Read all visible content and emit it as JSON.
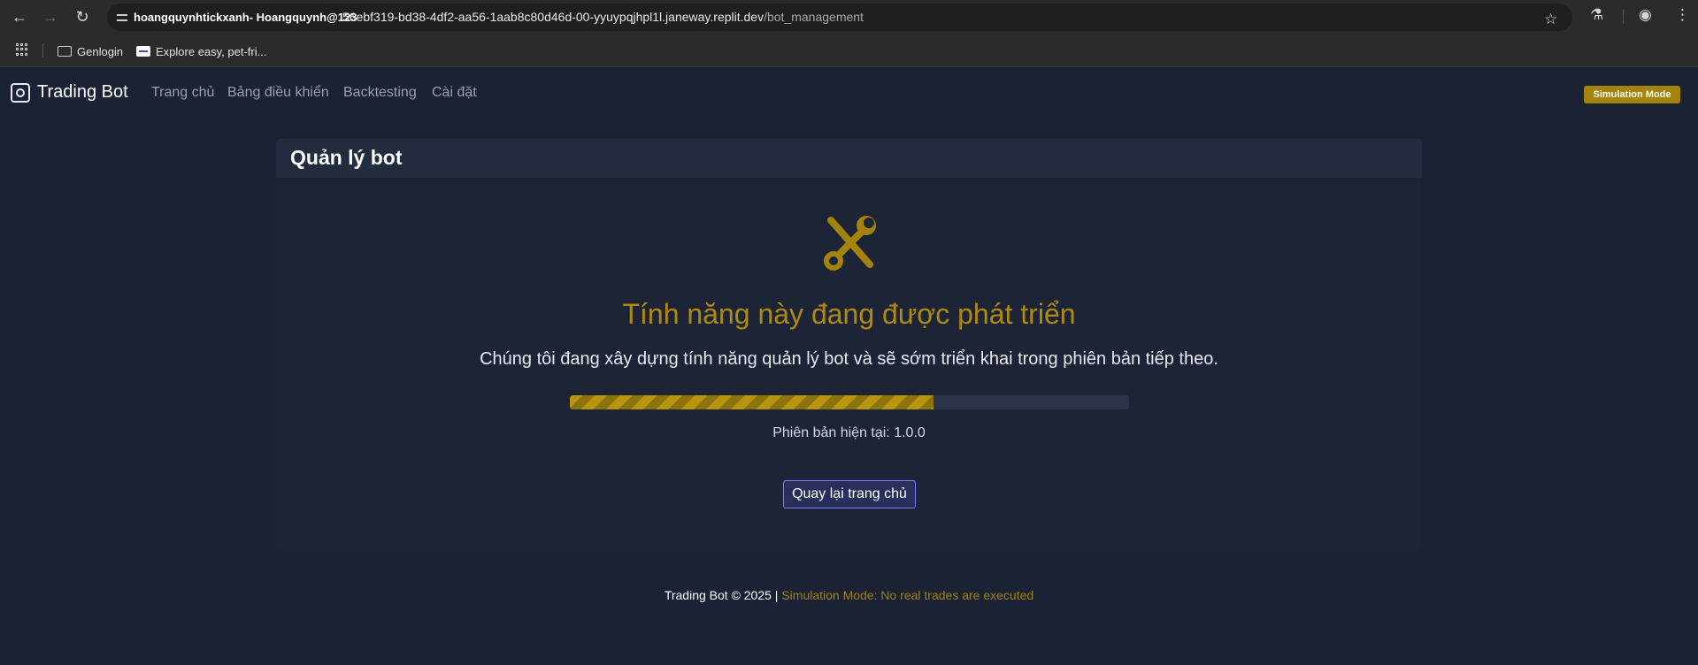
{
  "browser": {
    "site_chip": "hoangquynhtickxanh- Hoangquynh@123",
    "url_host": "56ebf319-bd38-4df2-aa56-1aab8c80d46d-00-yyuypqjhpl1l.janeway.replit.dev",
    "url_path": "/bot_management",
    "bookmarks": [
      {
        "label": "Genlogin",
        "icon": "folder-icon"
      },
      {
        "label": "Explore easy, pet-fri...",
        "icon": "site-favicon"
      }
    ]
  },
  "navbar": {
    "brand": "Trading Bot",
    "links": [
      "Trang chủ",
      "Bảng điều khiển",
      "Backtesting",
      "Cài đặt"
    ],
    "badge": "Simulation Mode"
  },
  "card": {
    "title": "Quản lý bot",
    "icon": "tools-icon",
    "heading": "Tính năng này đang được phát triển",
    "description": "Chúng tôi đang xây dựng tính năng quản lý bot và sẽ sớm triển khai trong phiên bản tiếp theo.",
    "progress_percent": 65,
    "version_text": "Phiên bản hiện tại: 1.0.0",
    "button_label": "Quay lại trang chủ"
  },
  "footer": {
    "text": "Trading Bot © 2025 |",
    "simulation_text": "Simulation Mode: No real trades are executed"
  },
  "colors": {
    "background": "#1b2233",
    "accent_gold": "#b08a10",
    "button_border": "#7a7dff"
  }
}
